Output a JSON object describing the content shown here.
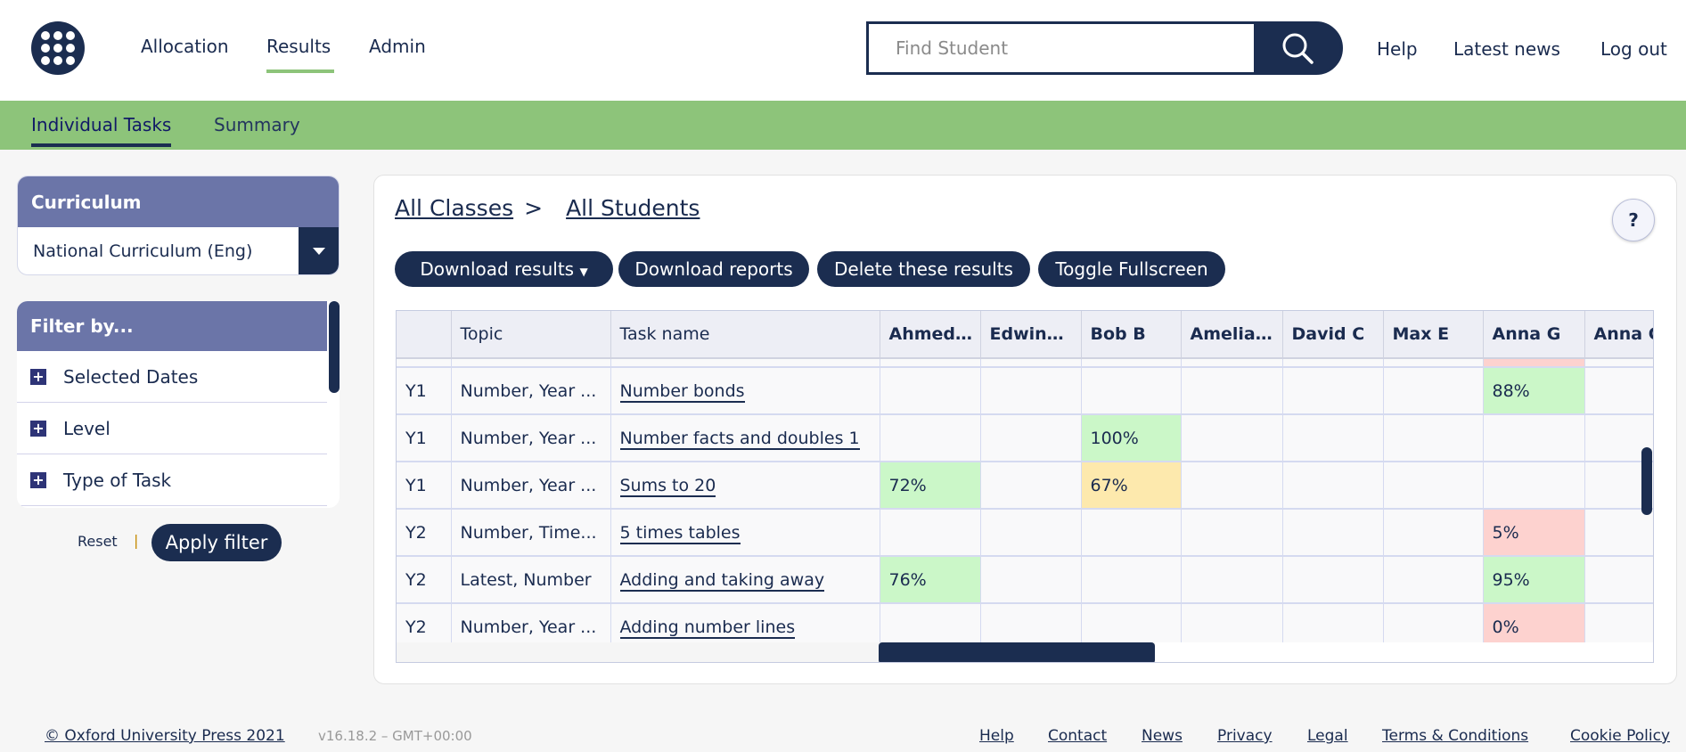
{
  "header": {
    "nav": [
      "Allocation",
      "Results",
      "Admin"
    ],
    "active_nav": "Results",
    "search_placeholder": "Find Student",
    "links": [
      "Help",
      "Latest news",
      "Log out"
    ]
  },
  "subnav": {
    "tabs": [
      "Individual Tasks",
      "Summary"
    ],
    "active": "Individual Tasks"
  },
  "curriculum": {
    "title": "Curriculum",
    "selected": "National Curriculum (Eng)"
  },
  "filter": {
    "title": "Filter by...",
    "items": [
      "Selected Dates",
      "Level",
      "Type of Task"
    ],
    "reset": "Reset",
    "separator": "|",
    "apply": "Apply filter"
  },
  "breadcrumb": {
    "classes": "All Classes",
    "sep": ">",
    "students": "All Students"
  },
  "help_button": "?",
  "actions": {
    "download_results": "Download results",
    "download_reports": "Download reports",
    "delete": "Delete these results",
    "fullscreen": "Toggle Fullscreen"
  },
  "table": {
    "columns": [
      "",
      "Topic",
      "Task name",
      "Ahmed…",
      "Edwin…",
      "Bob B",
      "Amelia…",
      "David C",
      "Max E",
      "Anna G",
      "Anna C"
    ],
    "rows": [
      {
        "year": "Y1",
        "topic": "Number, Year ...",
        "task": "Number bonds",
        "scores": [
          "",
          "",
          "",
          "",
          "",
          "",
          "88%",
          ""
        ]
      },
      {
        "year": "Y1",
        "topic": "Number, Year ...",
        "task": "Number facts and doubles 1",
        "scores": [
          "",
          "",
          "100%",
          "",
          "",
          "",
          "",
          ""
        ]
      },
      {
        "year": "Y1",
        "topic": "Number, Year ...",
        "task": "Sums to 20",
        "scores": [
          "72%",
          "",
          "67%",
          "",
          "",
          "",
          "",
          ""
        ]
      },
      {
        "year": "Y2",
        "topic": "Number, Time...",
        "task": "5 times tables",
        "scores": [
          "",
          "",
          "",
          "",
          "",
          "",
          "5%",
          ""
        ]
      },
      {
        "year": "Y2",
        "topic": "Latest, Number",
        "task": "Adding and taking away",
        "scores": [
          "76%",
          "",
          "",
          "",
          "",
          "",
          "95%",
          ""
        ]
      },
      {
        "year": "Y2",
        "topic": "Number, Year ...",
        "task": "Adding number lines",
        "scores": [
          "",
          "",
          "",
          "",
          "",
          "",
          "0%",
          ""
        ]
      }
    ],
    "colors": {
      "high": "#cbf7c8",
      "mid": "#fde9ad",
      "low": "#fdd2cf"
    }
  },
  "footer": {
    "copyright": "© Oxford University Press 2021",
    "version": "v16.18.2 – GMT+00:00",
    "links": [
      "Help",
      "Contact",
      "News",
      "Privacy",
      "Legal",
      "Terms & Conditions",
      "Cookie Policy"
    ]
  }
}
